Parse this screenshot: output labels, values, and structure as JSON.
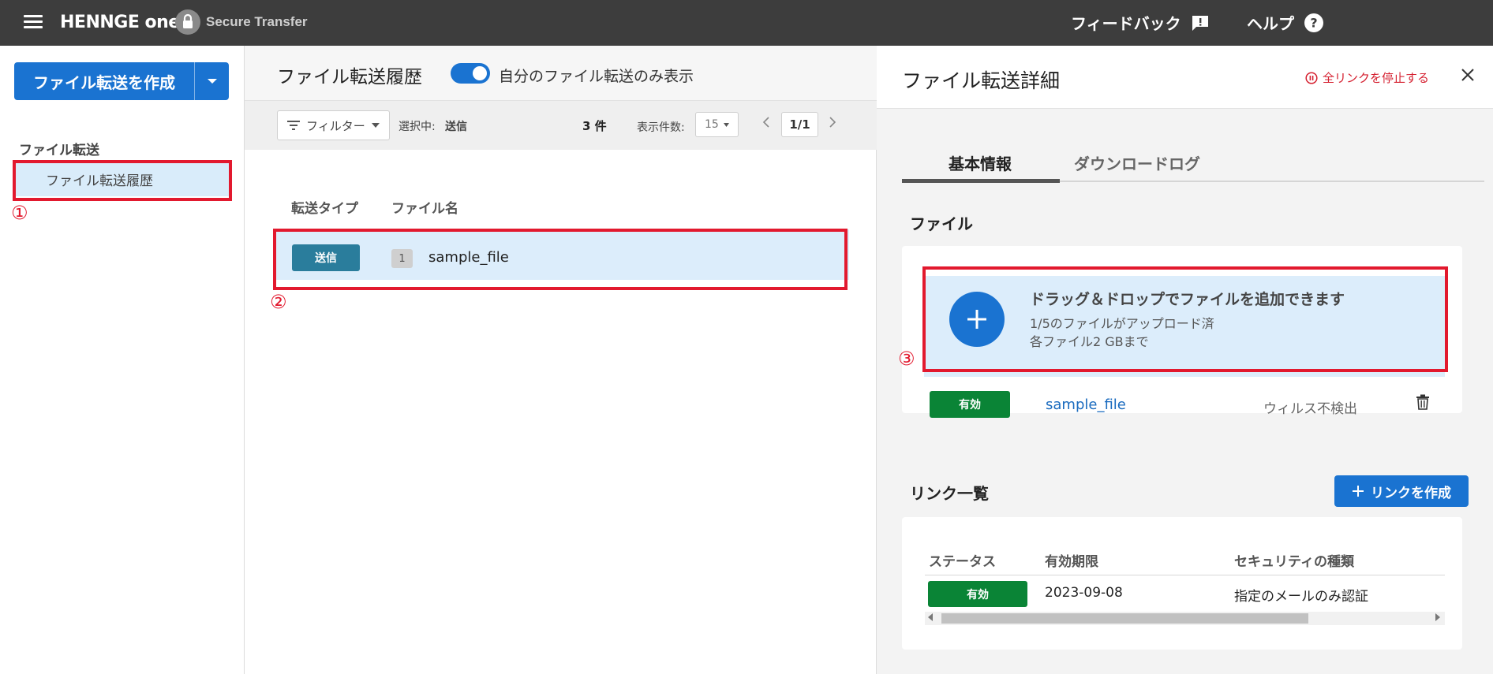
{
  "header": {
    "logo": "HENNGE one",
    "product": "Secure Transfer",
    "feedback": "フィードバック",
    "help": "ヘルプ"
  },
  "sidebar": {
    "create_button": "ファイル転送を作成",
    "section_title": "ファイル転送",
    "items": [
      {
        "label": "ファイル転送履歴",
        "active": true
      }
    ]
  },
  "annotations": {
    "step1": "①",
    "step2": "②",
    "step3": "③",
    "color": "#e2192e"
  },
  "history": {
    "title": "ファイル転送履歴",
    "toggle_label": "自分のファイル転送のみ表示",
    "toggle_on": true,
    "filter_label": "フィルター",
    "selected_label": "選択中:",
    "selected_value": "送信",
    "count": "3 件",
    "per_page_label": "表示件数:",
    "per_page_value": "15",
    "page": "1/1",
    "columns": [
      "転送タイプ",
      "ファイル名"
    ],
    "rows": [
      {
        "type": "送信",
        "file_count": "1",
        "file_name": "sample_file"
      }
    ]
  },
  "details": {
    "title": "ファイル転送詳細",
    "stop_all_links": "全リンクを停止する",
    "tabs": [
      "基本情報",
      "ダウンロードログ"
    ],
    "active_tab": 0,
    "files_section": "ファイル",
    "dropzone": {
      "main": "ドラッグ＆ドロップでファイルを追加できます",
      "uploaded": "1/5のファイルがアップロード済",
      "limit": "各ファイル2 GBまで"
    },
    "files": [
      {
        "status": "有効",
        "name": "sample_file",
        "scan": "ウィルス不検出"
      }
    ],
    "links_section": "リンク一覧",
    "create_link_button": "リンクを作成",
    "link_columns": [
      "ステータス",
      "有効期限",
      "セキュリティの種類"
    ],
    "links": [
      {
        "status": "有効",
        "expires": "2023-09-08",
        "security": "指定のメールのみ認証"
      }
    ]
  },
  "colors": {
    "topbar": "#3d3d3d",
    "primary": "#1a73d1",
    "active_status": "#0a8436",
    "send_badge": "#2a7d9c",
    "selected_row": "#dcedfb",
    "danger": "#d52030"
  }
}
